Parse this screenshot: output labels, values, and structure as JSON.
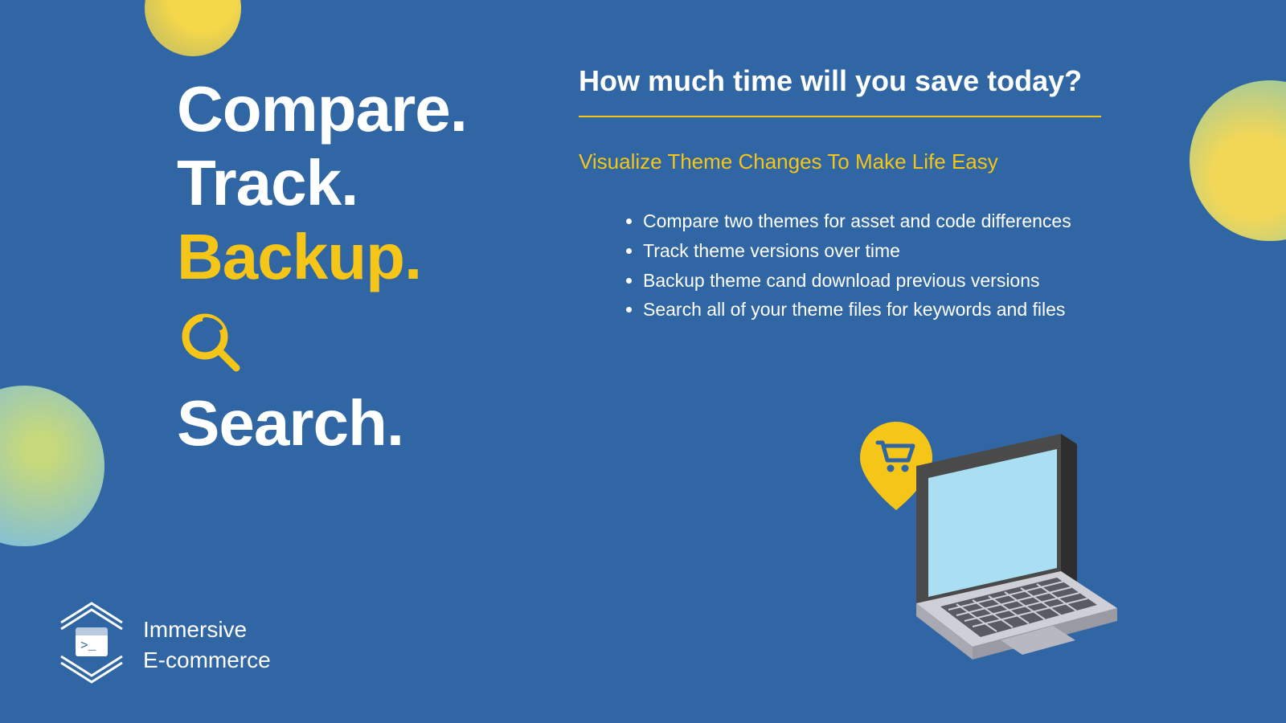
{
  "left": {
    "word1": "Compare.",
    "word2": "Track.",
    "word3": "Backup.",
    "word4": "Search."
  },
  "right": {
    "headline": "How much time will you save today?",
    "subhead": "Visualize Theme Changes To Make Life Easy",
    "features": [
      "Compare two themes for asset and code differences",
      "Track theme versions over time",
      "Backup theme cand download previous versions",
      "Search all of your theme files for keywords and files"
    ]
  },
  "brand": {
    "line1": "Immersive",
    "line2": "E-commerce"
  },
  "icons": {
    "search": "search-icon",
    "cart": "cart-icon",
    "laptop": "laptop-icon",
    "logo": "brand-logo-icon"
  }
}
